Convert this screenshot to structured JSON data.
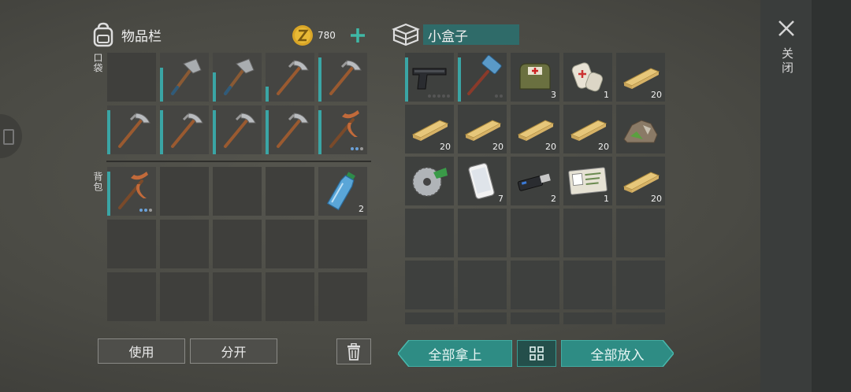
{
  "inventory": {
    "title": "物品栏",
    "coins": "780",
    "pocket_label": "口袋",
    "backpack_label": "背包"
  },
  "container": {
    "title": "小盒子"
  },
  "actions": {
    "use": "使用",
    "split": "分开",
    "take_all": "全部拿上",
    "put_all": "全部放入"
  },
  "close": {
    "label": "关闭"
  },
  "pocket_items": [
    {
      "icon": "empty"
    },
    {
      "icon": "hatchet-icon",
      "dur": 0.7
    },
    {
      "icon": "hatchet-icon",
      "dur": 0.6
    },
    {
      "icon": "pickaxe-icon",
      "dur": 0.3
    },
    {
      "icon": "pickaxe-icon",
      "dur": 0.9
    },
    {
      "icon": "pickaxe-icon",
      "dur": 0.9
    },
    {
      "icon": "pickaxe-icon",
      "dur": 0.9
    },
    {
      "icon": "pickaxe-icon",
      "dur": 0.9
    },
    {
      "icon": "pickaxe-icon",
      "dur": 0.9
    },
    {
      "icon": "copper-pickaxe-icon",
      "dur": 0.9,
      "dots": "bbg"
    }
  ],
  "backpack_items": [
    {
      "icon": "copper-pickaxe-icon",
      "dur": 0.9,
      "dots": "bbg"
    },
    {
      "icon": "empty"
    },
    {
      "icon": "empty"
    },
    {
      "icon": "empty"
    },
    {
      "icon": "water-bottle-icon",
      "qty": "2"
    },
    {
      "icon": "empty"
    },
    {
      "icon": "empty"
    },
    {
      "icon": "empty"
    },
    {
      "icon": "empty"
    },
    {
      "icon": "empty"
    },
    {
      "icon": "empty"
    },
    {
      "icon": "empty"
    },
    {
      "icon": "empty"
    },
    {
      "icon": "empty"
    },
    {
      "icon": "empty"
    }
  ],
  "box_items": [
    {
      "icon": "pistol-icon",
      "dur": 0.9,
      "dots": "ddddd"
    },
    {
      "icon": "sledgehammer-icon",
      "dur": 0.9,
      "dots": "dd"
    },
    {
      "icon": "medkit-bag-icon",
      "qty": "3"
    },
    {
      "icon": "bandage-icon",
      "qty": "1"
    },
    {
      "icon": "wood-plank-icon",
      "qty": "20"
    },
    {
      "icon": "wood-plank-icon",
      "qty": "20"
    },
    {
      "icon": "wood-plank-icon",
      "qty": "20"
    },
    {
      "icon": "wood-plank-icon",
      "qty": "20"
    },
    {
      "icon": "wood-plank-icon",
      "qty": "20"
    },
    {
      "icon": "scrap-pile-icon"
    },
    {
      "icon": "saw-blade-icon"
    },
    {
      "icon": "smartphone-icon",
      "qty": "7"
    },
    {
      "icon": "usb-drive-icon",
      "qty": "2"
    },
    {
      "icon": "army-id-card-icon",
      "qty": "1"
    },
    {
      "icon": "wood-plank-icon",
      "qty": "20"
    }
  ],
  "colors": {
    "accent": "#3aa5a5",
    "coin": "#d9a526",
    "teal_button": "#2e8c84"
  }
}
